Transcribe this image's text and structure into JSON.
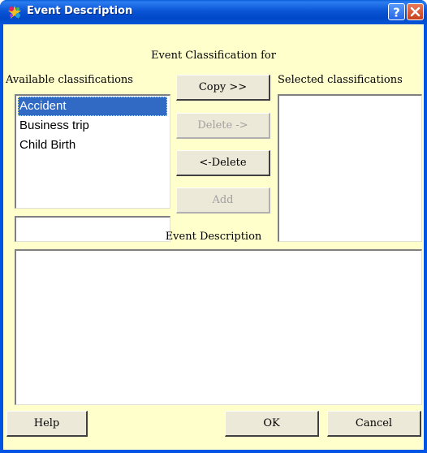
{
  "window": {
    "title": "Event Description"
  },
  "header": {
    "classification_for": "Event Classification for"
  },
  "available": {
    "label": "Available classifications",
    "items": [
      "Accident",
      "Business trip",
      "Child Birth"
    ],
    "selected_index": 0,
    "new_value": ""
  },
  "selected": {
    "label": "Selected classifications",
    "items": []
  },
  "buttons": {
    "copy": "Copy >>",
    "delete_right": "Delete ->",
    "delete_left": "<-Delete",
    "add": "Add",
    "help": "Help",
    "ok": "OK",
    "cancel": "Cancel"
  },
  "description": {
    "label": "Event Description",
    "value": ""
  },
  "icons": {
    "app": "colorful-star-icon",
    "help": "question-mark-icon",
    "close": "close-x-icon"
  },
  "colors": {
    "titlebar": "#0054e3",
    "client_background": "#ffffcc",
    "selection": "#316ac5"
  }
}
